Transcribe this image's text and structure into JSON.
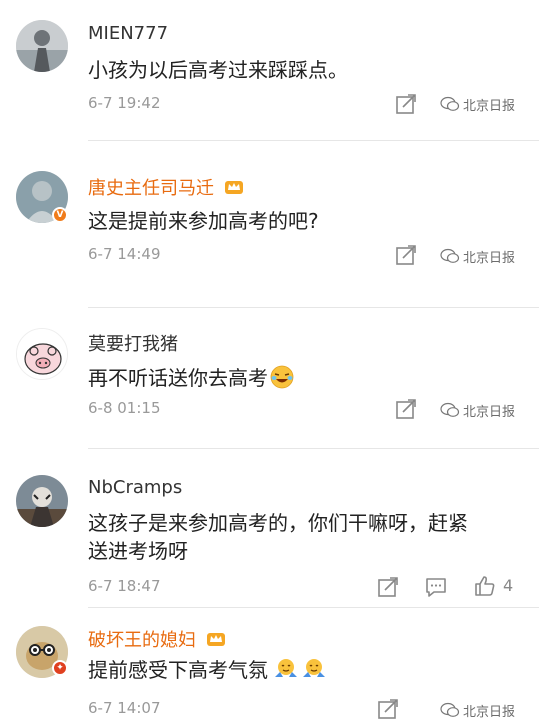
{
  "comments": [
    {
      "user": "MIEN777",
      "text": "小孩为以后高考过来踩踩点。",
      "time": "6-7 19:42"
    },
    {
      "user": "唐史主任司马迁",
      "text": "这是提前来参加高考的吧?",
      "time": "6-7 14:49"
    },
    {
      "user": "莫要打我猪",
      "text": "再不听话送你去高考",
      "time": "6-8 01:15"
    },
    {
      "user": "NbCramps",
      "text_line1": "这孩子是来参加高考的，你们干嘛呀，赶紧",
      "text_line2": "送进考场呀",
      "time": "6-7 18:47",
      "likes": "4"
    },
    {
      "user": "破坏王的媳妇",
      "text": "提前感受下高考气氛",
      "time": "6-7 14:07"
    }
  ],
  "watermark": "北京日报",
  "colors": {
    "vip_name": "#e86b10",
    "text": "#222222",
    "meta": "#999999"
  },
  "icons": [
    "repost-icon",
    "comment-icon",
    "like-icon",
    "crown-icon",
    "wechat-icon",
    "verified-badge"
  ]
}
